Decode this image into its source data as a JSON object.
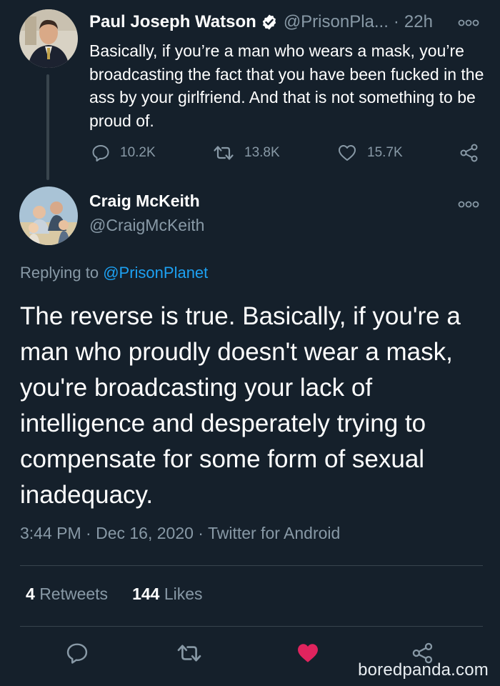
{
  "parent_tweet": {
    "author_name": "Paul Joseph Watson",
    "author_handle": "@PrisonPla...",
    "separator": "·",
    "time": "22h",
    "text": "Basically, if you’re a man who wears a mask, you’re broadcasting the fact that you have been fucked in the ass by your girlfriend. And that is not something to be proud of.",
    "replies": "10.2K",
    "retweets": "13.8K",
    "likes": "15.7K"
  },
  "main_tweet": {
    "author_name": "Craig McKeith",
    "author_handle": "@CraigMcKeith",
    "replying_prefix": "Replying to",
    "replying_handle": "@PrisonPlanet",
    "text": "The reverse is true. Basically, if you're a man who proudly doesn't wear a mask, you're broadcasting your lack of intelligence and desperately trying to compensate for some form of sexual inadequacy.",
    "meta": "3:44 PM · Dec 16, 2020 · Twitter for Android",
    "retweets_count": "4",
    "retweets_label": "Retweets",
    "likes_count": "144",
    "likes_label": "Likes"
  },
  "watermark": "boredpanda.com",
  "colors": {
    "background": "#15202b",
    "muted": "#8899a6",
    "link": "#1da1f2",
    "like_active": "#e0245e",
    "verified": "#ffffff"
  }
}
